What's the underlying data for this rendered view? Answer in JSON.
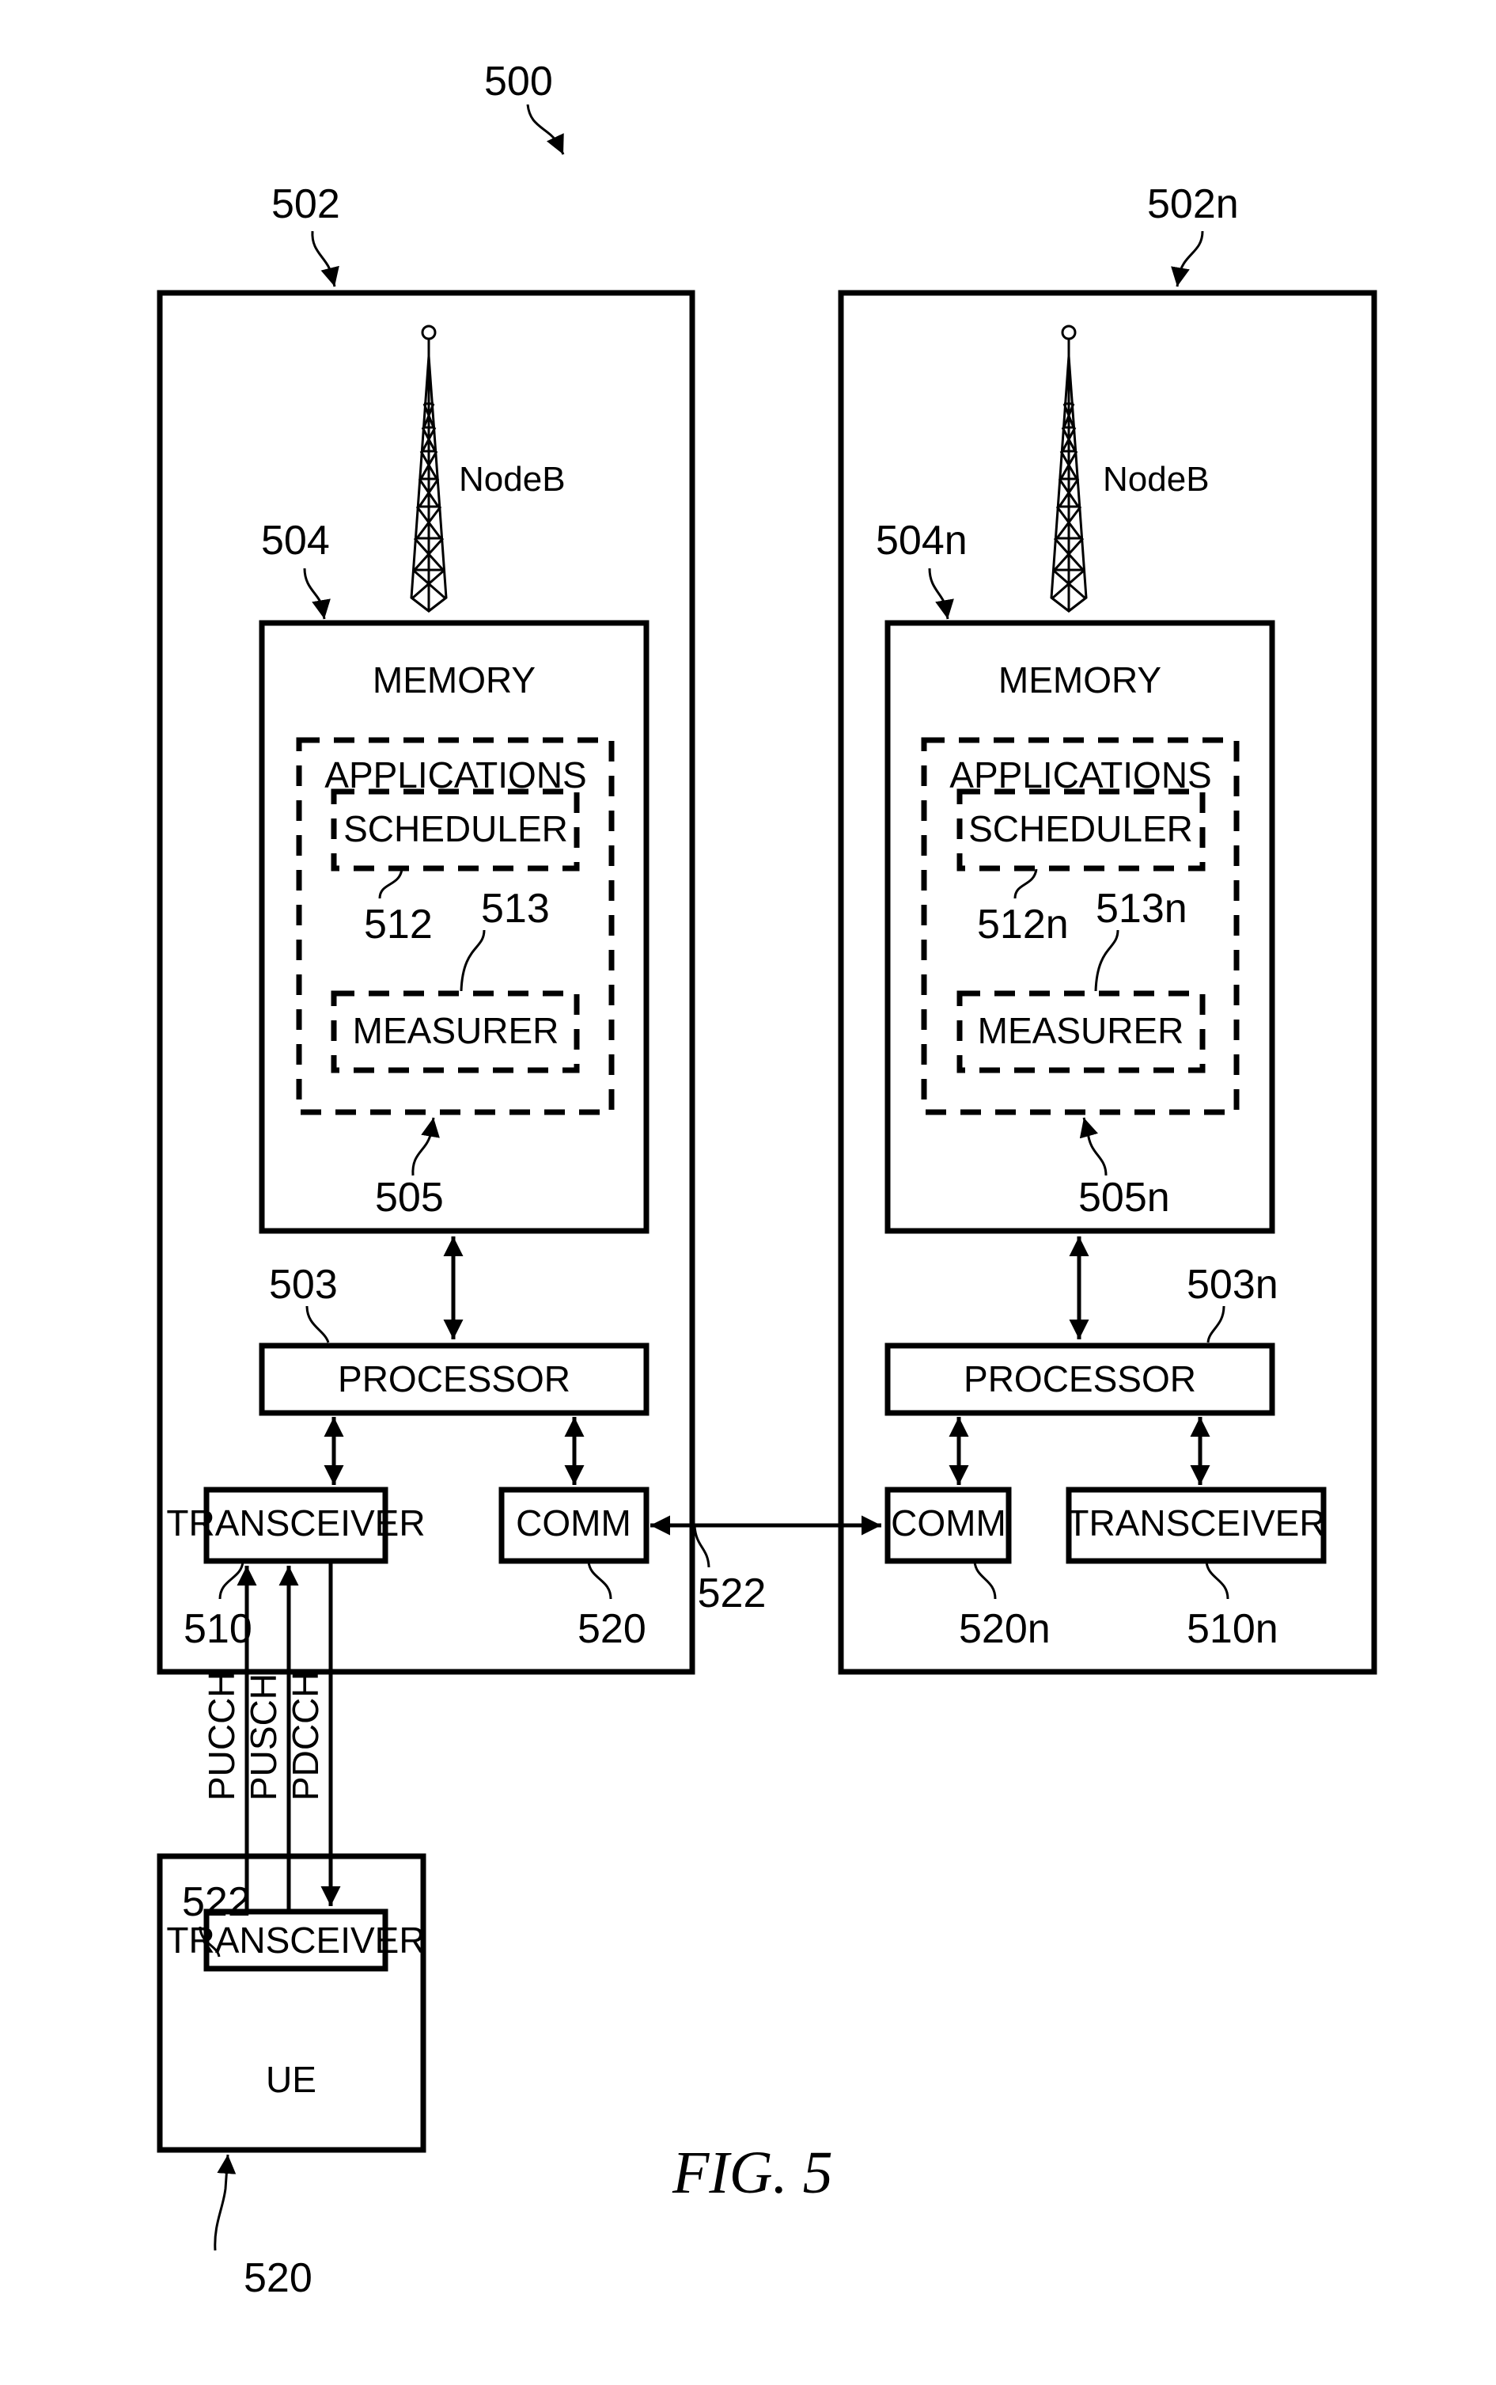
{
  "figure": {
    "caption": "FIG. 5",
    "system_ref": "500"
  },
  "nodeb_left": {
    "ref": "502",
    "antenna_label": "NodeB",
    "memory_ref": "504",
    "memory_label": "MEMORY",
    "applications_label": "APPLICATIONS",
    "applications_ref": "505",
    "scheduler_label": "SCHEDULER",
    "scheduler_ref": "512",
    "measurer_label": "MEASURER",
    "measurer_ref": "513",
    "processor_label": "PROCESSOR",
    "processor_ref": "503",
    "transceiver_label": "TRANSCEIVER",
    "transceiver_ref": "510",
    "comm_label": "COMM",
    "comm_ref": "520"
  },
  "nodeb_right": {
    "ref": "502n",
    "antenna_label": "NodeB",
    "memory_ref": "504n",
    "memory_label": "MEMORY",
    "applications_label": "APPLICATIONS",
    "applications_ref": "505n",
    "scheduler_label": "SCHEDULER",
    "scheduler_ref": "512n",
    "measurer_label": "MEASURER",
    "measurer_ref": "513n",
    "processor_label": "PROCESSOR",
    "processor_ref": "503n",
    "transceiver_label": "TRANSCEIVER",
    "transceiver_ref": "510n",
    "comm_label": "COMM",
    "comm_ref": "520n"
  },
  "backhaul_link": {
    "ref": "522"
  },
  "channels": [
    "PUCCH",
    "PUSCH",
    "PDCCH"
  ],
  "ue": {
    "label": "UE",
    "ref": "520",
    "transceiver_label": "TRANSCEIVER",
    "transceiver_ref": "522"
  }
}
